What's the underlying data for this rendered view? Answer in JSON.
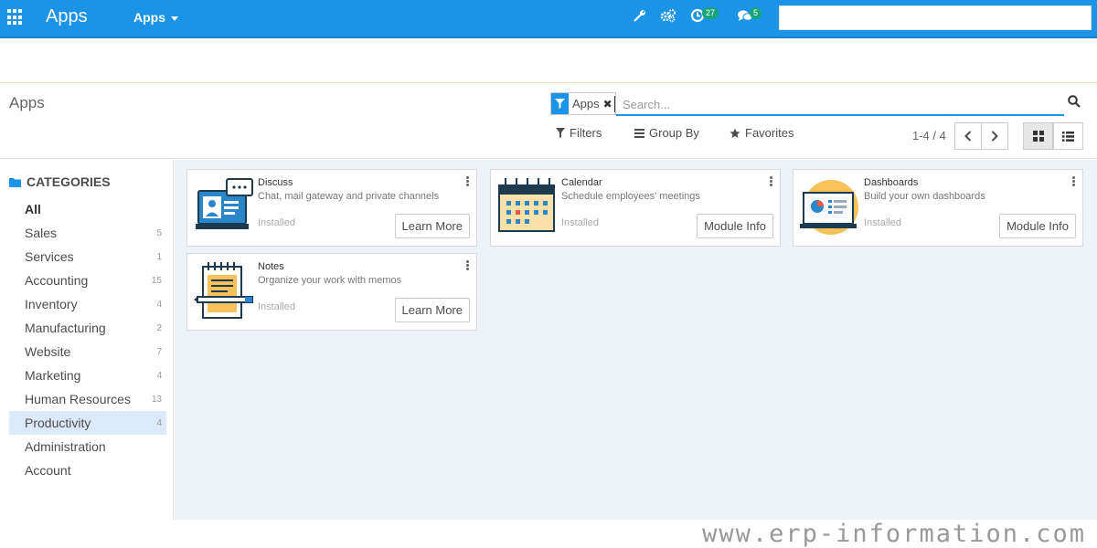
{
  "topbar": {
    "app_title": "Apps",
    "apps_menu": "Apps",
    "activity_count": "27",
    "messages_count": "5",
    "colors": {
      "bar": "#1b93e6",
      "badge": "#18a57a"
    }
  },
  "control": {
    "breadcrumb": "Apps",
    "facet_value": "Apps",
    "search_placeholder": "Search...",
    "filters_label": "Filters",
    "groupby_label": "Group By",
    "favorites_label": "Favorites",
    "pager": "1-4 / 4"
  },
  "sidebar": {
    "header": "CATEGORIES",
    "items": [
      {
        "label": "All",
        "count": ""
      },
      {
        "label": "Sales",
        "count": "5"
      },
      {
        "label": "Services",
        "count": "1"
      },
      {
        "label": "Accounting",
        "count": "15"
      },
      {
        "label": "Inventory",
        "count": "4"
      },
      {
        "label": "Manufacturing",
        "count": "2"
      },
      {
        "label": "Website",
        "count": "7"
      },
      {
        "label": "Marketing",
        "count": "4"
      },
      {
        "label": "Human Resources",
        "count": "13"
      },
      {
        "label": "Productivity",
        "count": "4"
      },
      {
        "label": "Administration",
        "count": ""
      },
      {
        "label": "Account",
        "count": ""
      }
    ],
    "active": "Productivity"
  },
  "cards": [
    {
      "name": "Discuss",
      "desc": "Chat, mail gateway and private channels",
      "status": "Installed",
      "button": "Learn More",
      "icon": "discuss-icon"
    },
    {
      "name": "Calendar",
      "desc": "Schedule employees' meetings",
      "status": "Installed",
      "button": "Module Info",
      "icon": "calendar-icon"
    },
    {
      "name": "Dashboards",
      "desc": "Build your own dashboards",
      "status": "Installed",
      "button": "Module Info",
      "icon": "dashboards-icon"
    },
    {
      "name": "Notes",
      "desc": "Organize your work with memos",
      "status": "Installed",
      "button": "Learn More",
      "icon": "notes-icon"
    }
  ],
  "watermark": "www.erp-information.com"
}
